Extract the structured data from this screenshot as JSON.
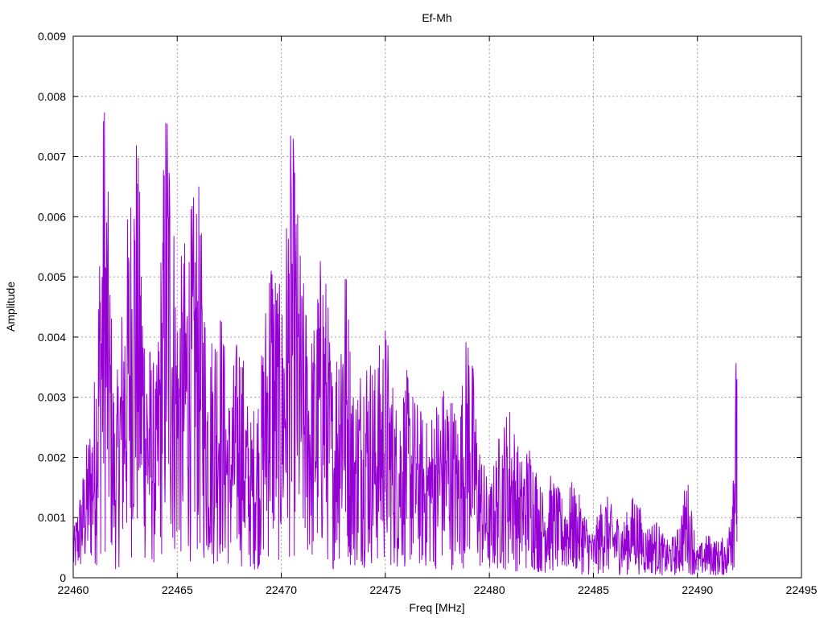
{
  "chart_data": {
    "type": "line",
    "title": "Ef-Mh",
    "xlabel": "Freq [MHz]",
    "ylabel": "Amplitude",
    "xlim": [
      22460,
      22495
    ],
    "ylim": [
      0,
      0.009
    ],
    "grid": true,
    "legend": "none",
    "x_ticks": [
      "22460",
      "22465",
      "22470",
      "22475",
      "22480",
      "22485",
      "22490",
      "22495"
    ],
    "y_ticks": [
      "0",
      "0.001",
      "0.002",
      "0.003",
      "0.004",
      "0.005",
      "0.006",
      "0.007",
      "0.008",
      "0.009"
    ],
    "series": [
      {
        "color": "#9400d3",
        "x": [
          22460.0,
          22460.5,
          22461.0,
          22461.5,
          22462.0,
          22462.5,
          22463.0,
          22463.5,
          22464.0,
          22464.5,
          22465.0,
          22465.5,
          22466.0,
          22466.5,
          22467.0,
          22467.5,
          22468.0,
          22468.5,
          22469.0,
          22469.5,
          22470.0,
          22470.5,
          22471.0,
          22471.5,
          22472.0,
          22472.5,
          22473.0,
          22473.5,
          22474.0,
          22474.5,
          22475.0,
          22475.5,
          22476.0,
          22476.5,
          22477.0,
          22477.5,
          22478.0,
          22478.5,
          22479.0,
          22479.5,
          22480.0,
          22480.5,
          22481.0,
          22481.5,
          22482.0,
          22482.5,
          22483.0,
          22483.5,
          22484.0,
          22484.5,
          22485.0,
          22485.5,
          22486.0,
          22486.5,
          22487.0,
          22487.5,
          22488.0,
          22488.5,
          22489.0,
          22489.5,
          22490.0,
          22490.5,
          22491.0,
          22491.5,
          22491.9
        ],
        "y": [
          0.0006,
          0.0015,
          0.0026,
          0.0068,
          0.0022,
          0.0045,
          0.0064,
          0.0035,
          0.0027,
          0.0071,
          0.004,
          0.0048,
          0.0054,
          0.0031,
          0.004,
          0.0025,
          0.0035,
          0.0021,
          0.0028,
          0.0049,
          0.0037,
          0.0062,
          0.0041,
          0.0033,
          0.0047,
          0.0027,
          0.0048,
          0.0025,
          0.0033,
          0.0029,
          0.0035,
          0.0024,
          0.0028,
          0.0024,
          0.0021,
          0.0025,
          0.0027,
          0.0022,
          0.0036,
          0.0019,
          0.0012,
          0.002,
          0.0024,
          0.0016,
          0.0019,
          0.0012,
          0.0014,
          0.0011,
          0.0013,
          0.001,
          0.0006,
          0.0012,
          0.0009,
          0.0008,
          0.0012,
          0.0007,
          0.0008,
          0.0005,
          0.0006,
          0.0014,
          0.0004,
          0.0006,
          0.0005,
          0.0006,
          0.0033
        ]
      }
    ]
  }
}
